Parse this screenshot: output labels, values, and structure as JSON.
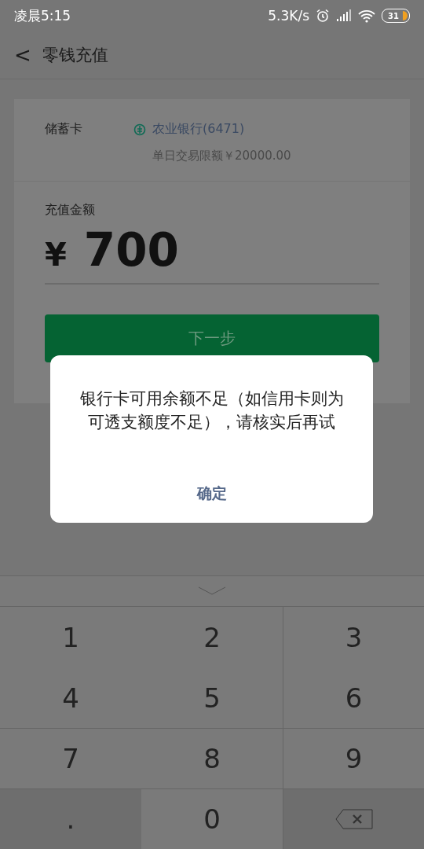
{
  "status_bar": {
    "time": "凌晨5:15",
    "speed": "5.3K/s",
    "battery": "31"
  },
  "header": {
    "back": "<",
    "title": "零钱充值"
  },
  "card": {
    "label": "储蓄卡",
    "bank": "农业银行(6471)",
    "limit": "单日交易限额￥20000.00"
  },
  "amount": {
    "label": "充值金额",
    "currency": "¥",
    "value": "700"
  },
  "next_button": "下一步",
  "dialog": {
    "message": "银行卡可用余额不足（如信用卡则为可透支额度不足），请核实后再试",
    "button": "确定"
  },
  "keypad": [
    {
      "label": "1",
      "kind": "digit"
    },
    {
      "label": "2",
      "kind": "digit"
    },
    {
      "label": "3",
      "kind": "digit"
    },
    {
      "label": "4",
      "kind": "digit"
    },
    {
      "label": "5",
      "kind": "digit"
    },
    {
      "label": "6",
      "kind": "digit"
    },
    {
      "label": "7",
      "kind": "digit"
    },
    {
      "label": "8",
      "kind": "digit"
    },
    {
      "label": "9",
      "kind": "digit"
    },
    {
      "label": ".",
      "kind": "dot"
    },
    {
      "label": "0",
      "kind": "digit"
    },
    {
      "kind": "backspace"
    }
  ]
}
